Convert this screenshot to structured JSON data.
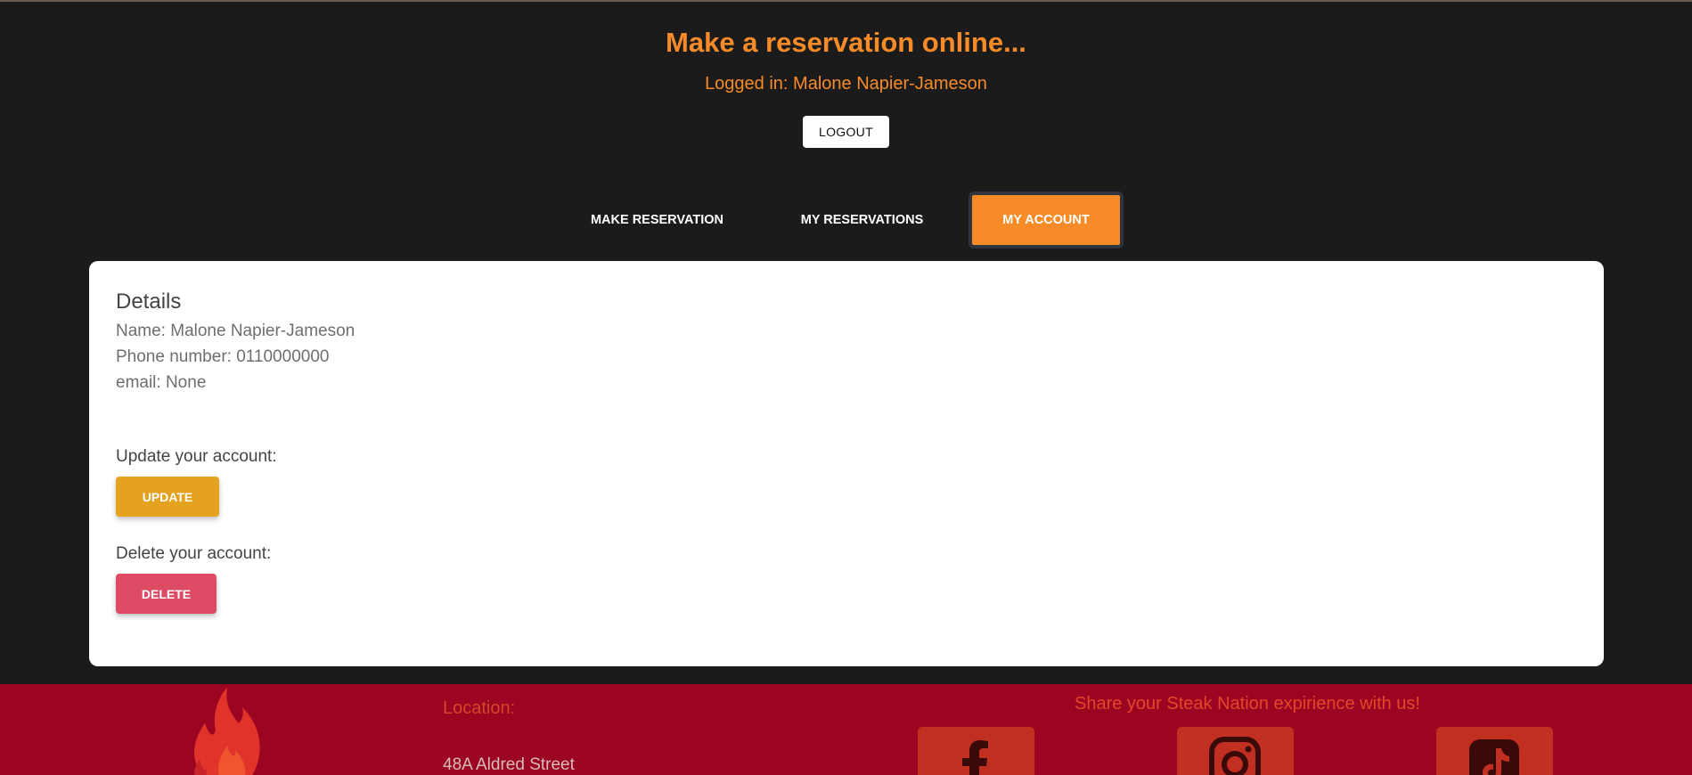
{
  "header": {
    "title": "Make a reservation online...",
    "logged_in": "Logged in: Malone Napier-Jameson",
    "logout_label": "LOGOUT"
  },
  "tabs": [
    {
      "label": "MAKE RESERVATION",
      "active": false
    },
    {
      "label": "MY RESERVATIONS",
      "active": false
    },
    {
      "label": "MY ACCOUNT",
      "active": true
    }
  ],
  "account": {
    "heading": "Details",
    "name": "Name: Malone Napier-Jameson",
    "phone": "Phone number: 0110000000",
    "email": "email: None",
    "update_label": "Update your account:",
    "update_button": "UPDATE",
    "delete_label": "Delete your account:",
    "delete_button": "DELETE"
  },
  "footer": {
    "location_label": "Location:",
    "address": "48A Aldred Street",
    "share_text": "Share your Steak Nation expirience with us!",
    "social_icons": [
      "facebook-icon",
      "instagram-icon",
      "tiktok-icon"
    ]
  },
  "colors": {
    "accent": "#f68b28",
    "background": "#1b1b1b",
    "update": "#e4a21f",
    "delete": "#dd4b64",
    "footer": "#9b0522"
  }
}
